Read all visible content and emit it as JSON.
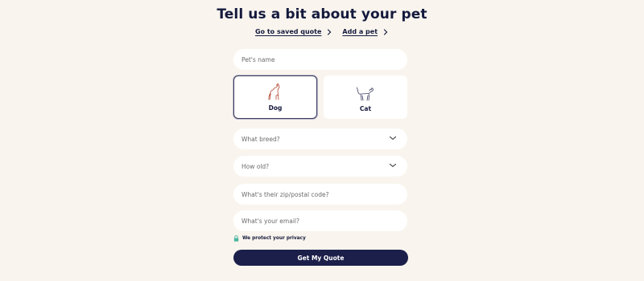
{
  "header": {
    "title": "Tell us a bit about your pet"
  },
  "links": [
    {
      "label": "Go to saved quote",
      "icon": "chevron-right-icon"
    },
    {
      "label": "Add a pet",
      "icon": "chevron-right-icon"
    }
  ],
  "form": {
    "pet_name_placeholder": "Pet's name",
    "pet_types": [
      {
        "label": "Dog",
        "icon": "dog-icon",
        "selected": true
      },
      {
        "label": "Cat",
        "icon": "cat-icon",
        "selected": false
      }
    ],
    "breed_placeholder": "What breed?",
    "age_placeholder": "How old?",
    "zip_placeholder": "What's their zip/postal code?",
    "email_placeholder": "What's your email?",
    "privacy_text": "We protect your privacy",
    "submit_label": "Get My Quote"
  },
  "colors": {
    "background": "#f9f5ee",
    "primary": "#1c1f4a",
    "dog_icon": "#b1462f",
    "lock_icon": "#4cb6a2"
  }
}
